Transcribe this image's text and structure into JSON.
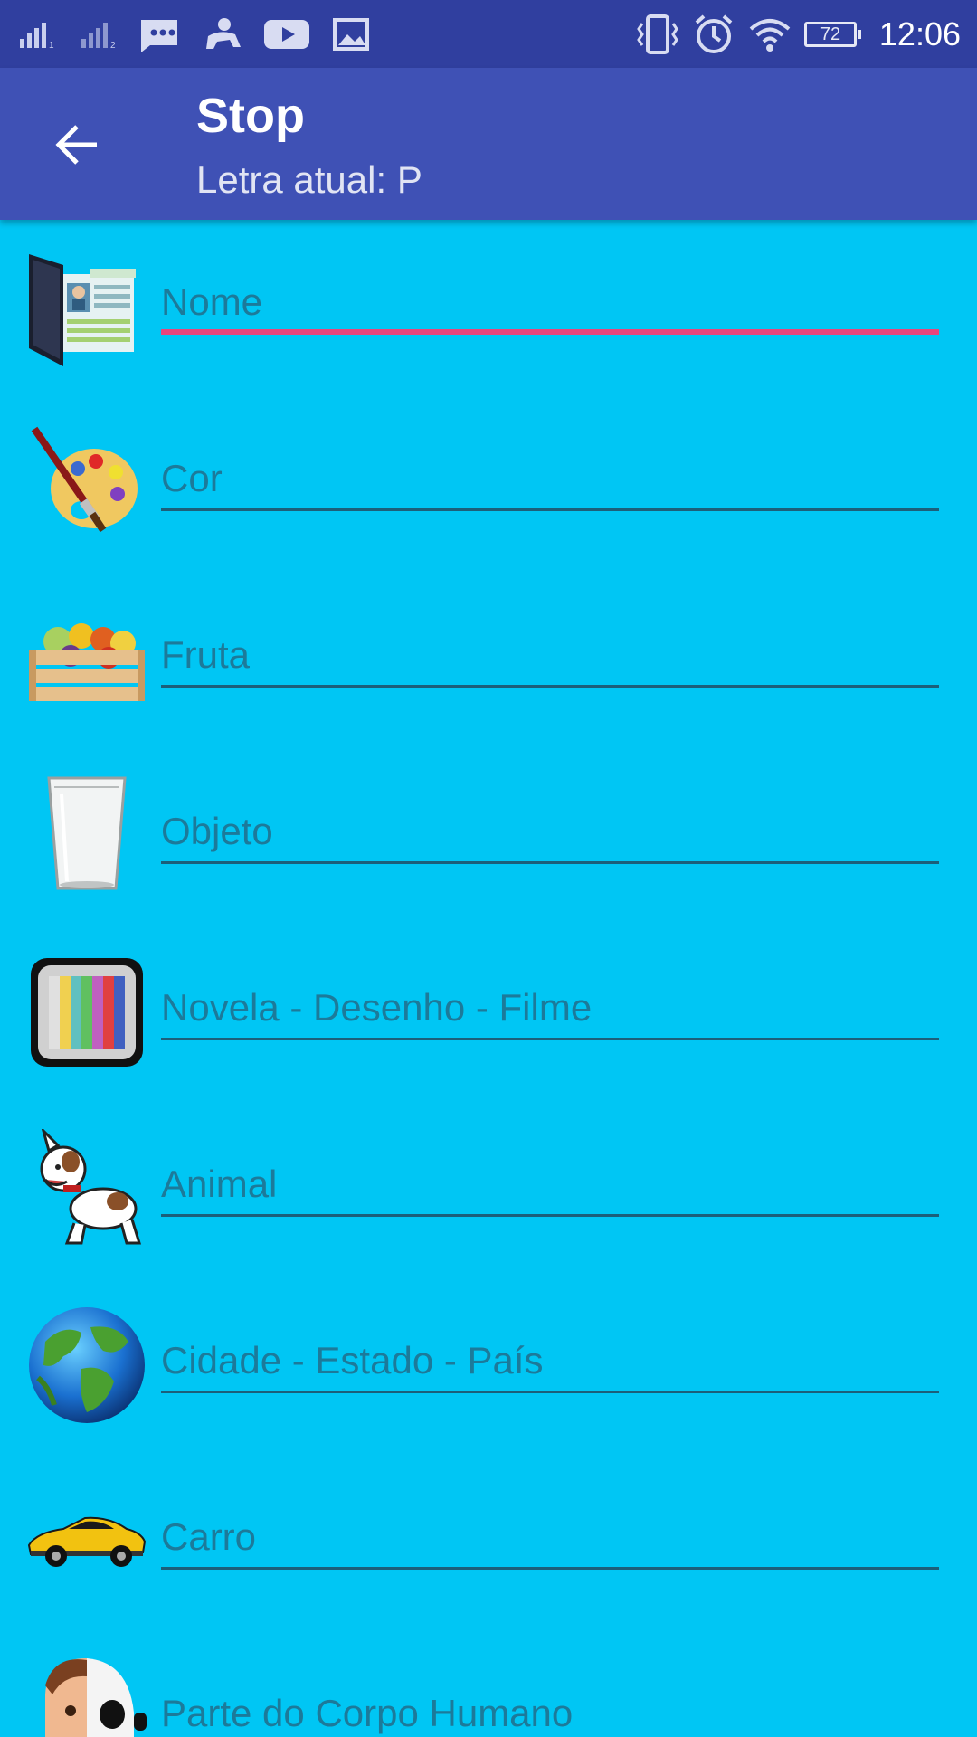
{
  "status_bar": {
    "time": "12:06",
    "battery": "72",
    "icons": [
      "signal-1-icon",
      "signal-2-icon",
      "message-icon",
      "baby-icon",
      "youtube-icon",
      "image-icon",
      "vibrate-icon",
      "alarm-icon",
      "wifi-icon",
      "battery-icon"
    ]
  },
  "app_bar": {
    "title": "Stop",
    "subtitle": "Letra atual: P",
    "back_icon": "arrow-back-icon"
  },
  "colors": {
    "status_bar": "#303f9f",
    "app_bar": "#3f51b5",
    "background": "#00c6f4",
    "focus_underline": "#e8467c",
    "underline": "#1c5f7a"
  },
  "fields": [
    {
      "placeholder": "Nome",
      "value": "",
      "icon": "id-folder-icon",
      "focused": true
    },
    {
      "placeholder": "Cor",
      "value": "",
      "icon": "paint-palette-icon",
      "focused": false
    },
    {
      "placeholder": "Fruta",
      "value": "",
      "icon": "fruit-crate-icon",
      "focused": false
    },
    {
      "placeholder": "Objeto",
      "value": "",
      "icon": "glass-icon",
      "focused": false
    },
    {
      "placeholder": "Novela - Desenho - Filme",
      "value": "",
      "icon": "tv-icon",
      "focused": false
    },
    {
      "placeholder": "Animal",
      "value": "",
      "icon": "dog-icon",
      "focused": false
    },
    {
      "placeholder": "Cidade - Estado - País",
      "value": "",
      "icon": "globe-icon",
      "focused": false
    },
    {
      "placeholder": "Carro",
      "value": "",
      "icon": "car-icon",
      "focused": false
    },
    {
      "placeholder": "Parte do Corpo Humano",
      "value": "",
      "icon": "human-body-icon",
      "focused": false
    }
  ]
}
